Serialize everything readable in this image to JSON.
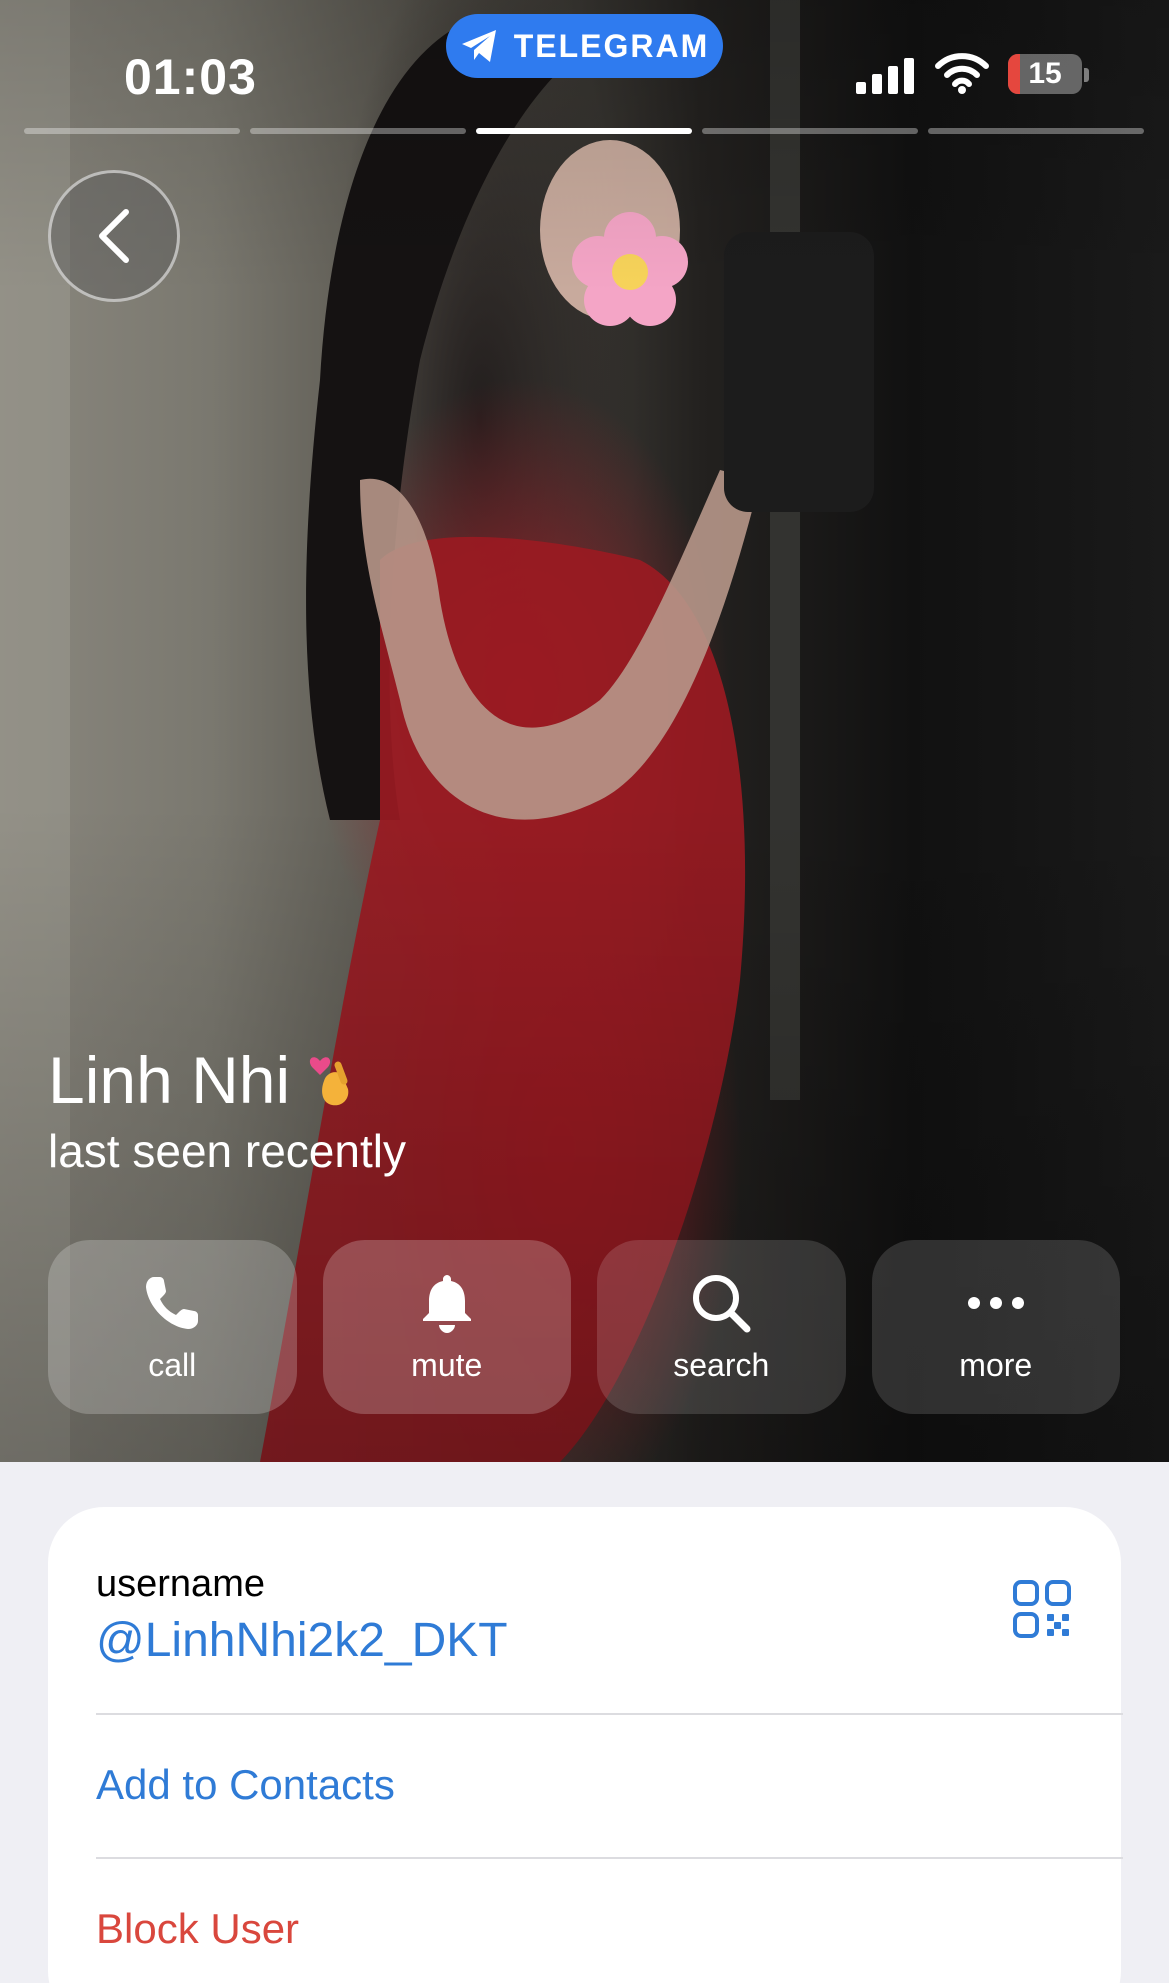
{
  "status_bar": {
    "time": "01:03",
    "app_pill": "TELEGRAM",
    "battery": "15"
  },
  "story": {
    "segments": 5,
    "active_segment": 3
  },
  "profile": {
    "name": "Linh Nhi",
    "status": "last seen recently"
  },
  "actions": [
    {
      "label": "call",
      "icon": "phone-icon"
    },
    {
      "label": "mute",
      "icon": "bell-icon"
    },
    {
      "label": "search",
      "icon": "search-icon"
    },
    {
      "label": "more",
      "icon": "more-icon"
    }
  ],
  "info": {
    "username_label": "username",
    "username": "@LinhNhi2k2_DKT",
    "add_contact": "Add to Contacts",
    "block_user": "Block User"
  },
  "colors": {
    "accent": "#2f7bd6",
    "danger": "#d9473d",
    "pill": "#2f7bef"
  }
}
